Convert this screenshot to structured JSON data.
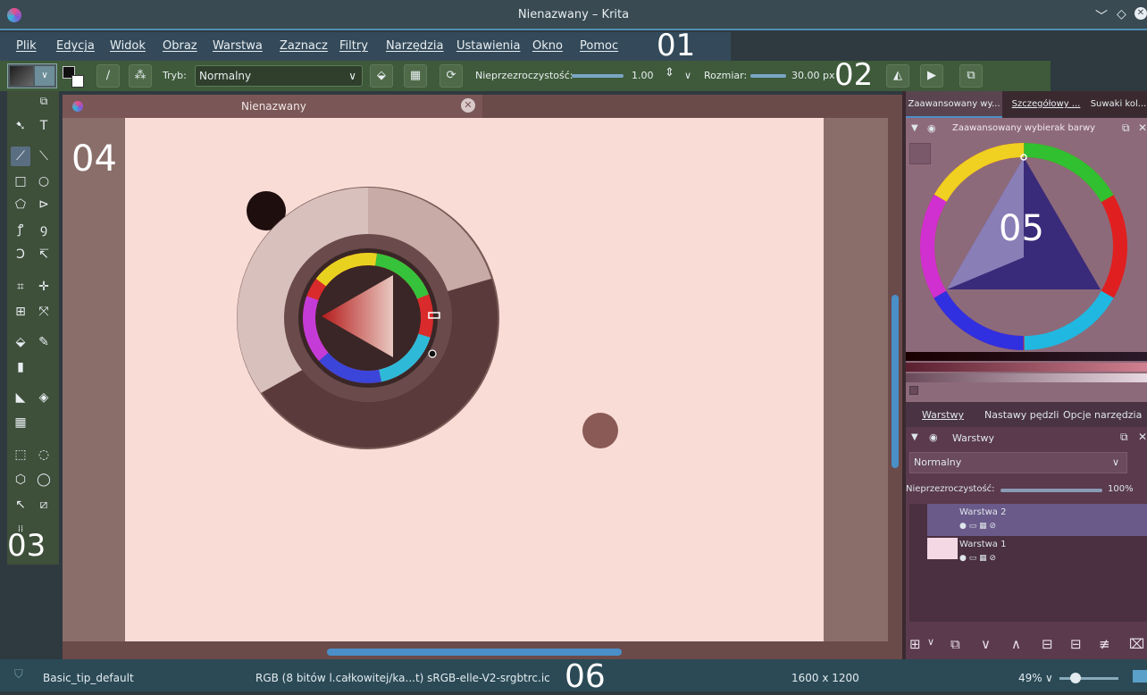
{
  "window": {
    "title": "Nienazwany – Krita"
  },
  "menu": [
    "Plik",
    "Edycja",
    "Widok",
    "Obraz",
    "Warstwa",
    "Zaznacz",
    "Filtry",
    "Narzędzia",
    "Ustawienia",
    "Okno",
    "Pomoc"
  ],
  "annotations": {
    "a01": "01",
    "a02": "02",
    "a03": "03",
    "a04": "04",
    "a05": "05",
    "a06": "06"
  },
  "toolbar": {
    "mode_label": "Tryb:",
    "mode_value": "Normalny",
    "opacity_label": "Nieprzezroczystość:",
    "opacity_value": "1.00",
    "size_label": "Rozmiar:",
    "size_value": "30.00 px"
  },
  "document": {
    "tab_title": "Nienazwany"
  },
  "dock": {
    "top_tabs": [
      "Zaawansowany wy...",
      "Szczegółowy ...",
      "Suwaki kol..."
    ],
    "color_title": "Zaawansowany wybierak barwy",
    "bottom_tabs": [
      "Warstwy",
      "Nastawy pędzli",
      "Opcje narzędzia"
    ],
    "layers_title": "Warstwy",
    "blend_mode": "Normalny",
    "opacity_label": "Nieprzezroczystość:",
    "opacity_value": "100%",
    "layers": [
      {
        "name": "Warstwa 2",
        "selected": true
      },
      {
        "name": "Warstwa 1",
        "selected": false
      }
    ]
  },
  "status": {
    "brush": "Basic_tip_default",
    "colorspace": "RGB (8 bitów l.całkowitej/ka...t)  sRGB-elle-V2-srgbtrc.ic",
    "dimensions": "1600 x 1200",
    "zoom": "49%"
  },
  "colors": {
    "accent": "#4a8fc8",
    "canvas": "#f9dcd6",
    "panel": "#3e5a3a"
  }
}
